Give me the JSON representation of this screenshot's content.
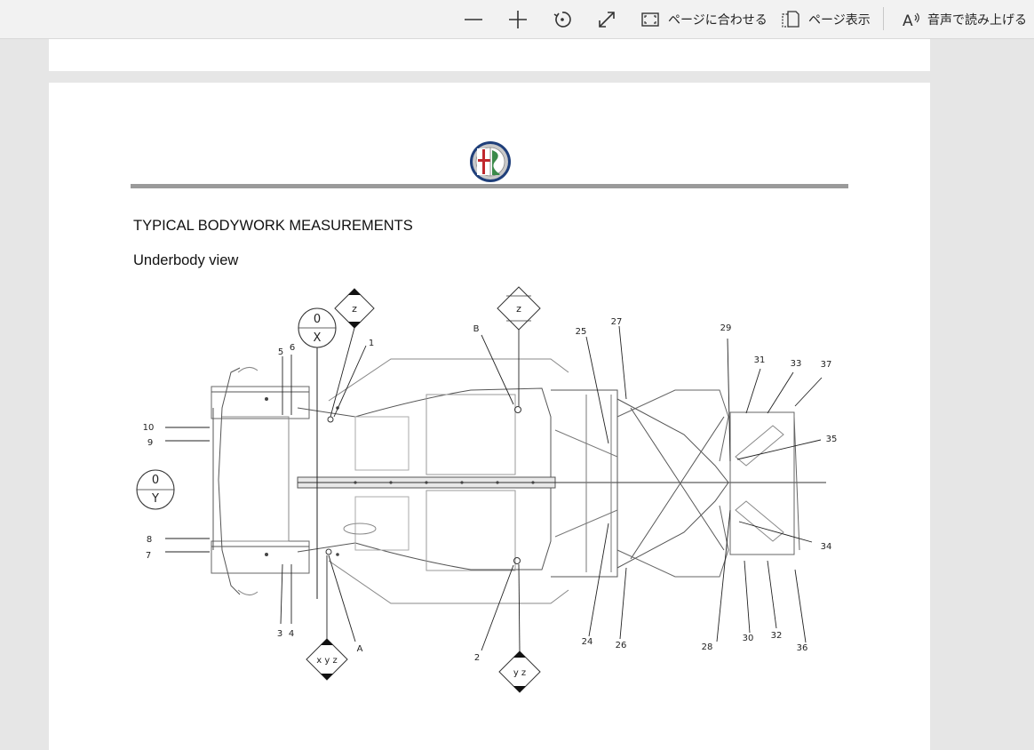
{
  "toolbar": {
    "zoom_out_icon": "minus-icon",
    "zoom_in_icon": "plus-icon",
    "rotate_icon": "rotate-icon",
    "fullscreen_icon": "expand-icon",
    "fit_page_label": "ページに合わせる",
    "page_view_label": "ページ表示",
    "read_aloud_label": "音声で読み上げる"
  },
  "document": {
    "heading": "TYPICAL BODYWORK MEASUREMENTS",
    "subheading": "Underbody view",
    "logo": "alfa-romeo-logo"
  },
  "diagram": {
    "callouts_top": [
      "5",
      "6",
      "1",
      "B",
      "25",
      "27",
      "29",
      "31",
      "33",
      "37"
    ],
    "callouts_left": [
      "10",
      "9",
      "8",
      "7"
    ],
    "callouts_bottom": [
      "3",
      "4",
      "A",
      "2",
      "24",
      "26",
      "28",
      "30",
      "32",
      "36"
    ],
    "callouts_right": [
      "35",
      "34"
    ],
    "diamond_top_left": "z",
    "diamond_top_mid": "z",
    "diamond_bottom_left": "x y z",
    "diamond_bottom_mid": "y z",
    "origin_x_zero": "0",
    "origin_x_axis": "X",
    "origin_y_zero": "0",
    "origin_y_axis": "Y"
  }
}
